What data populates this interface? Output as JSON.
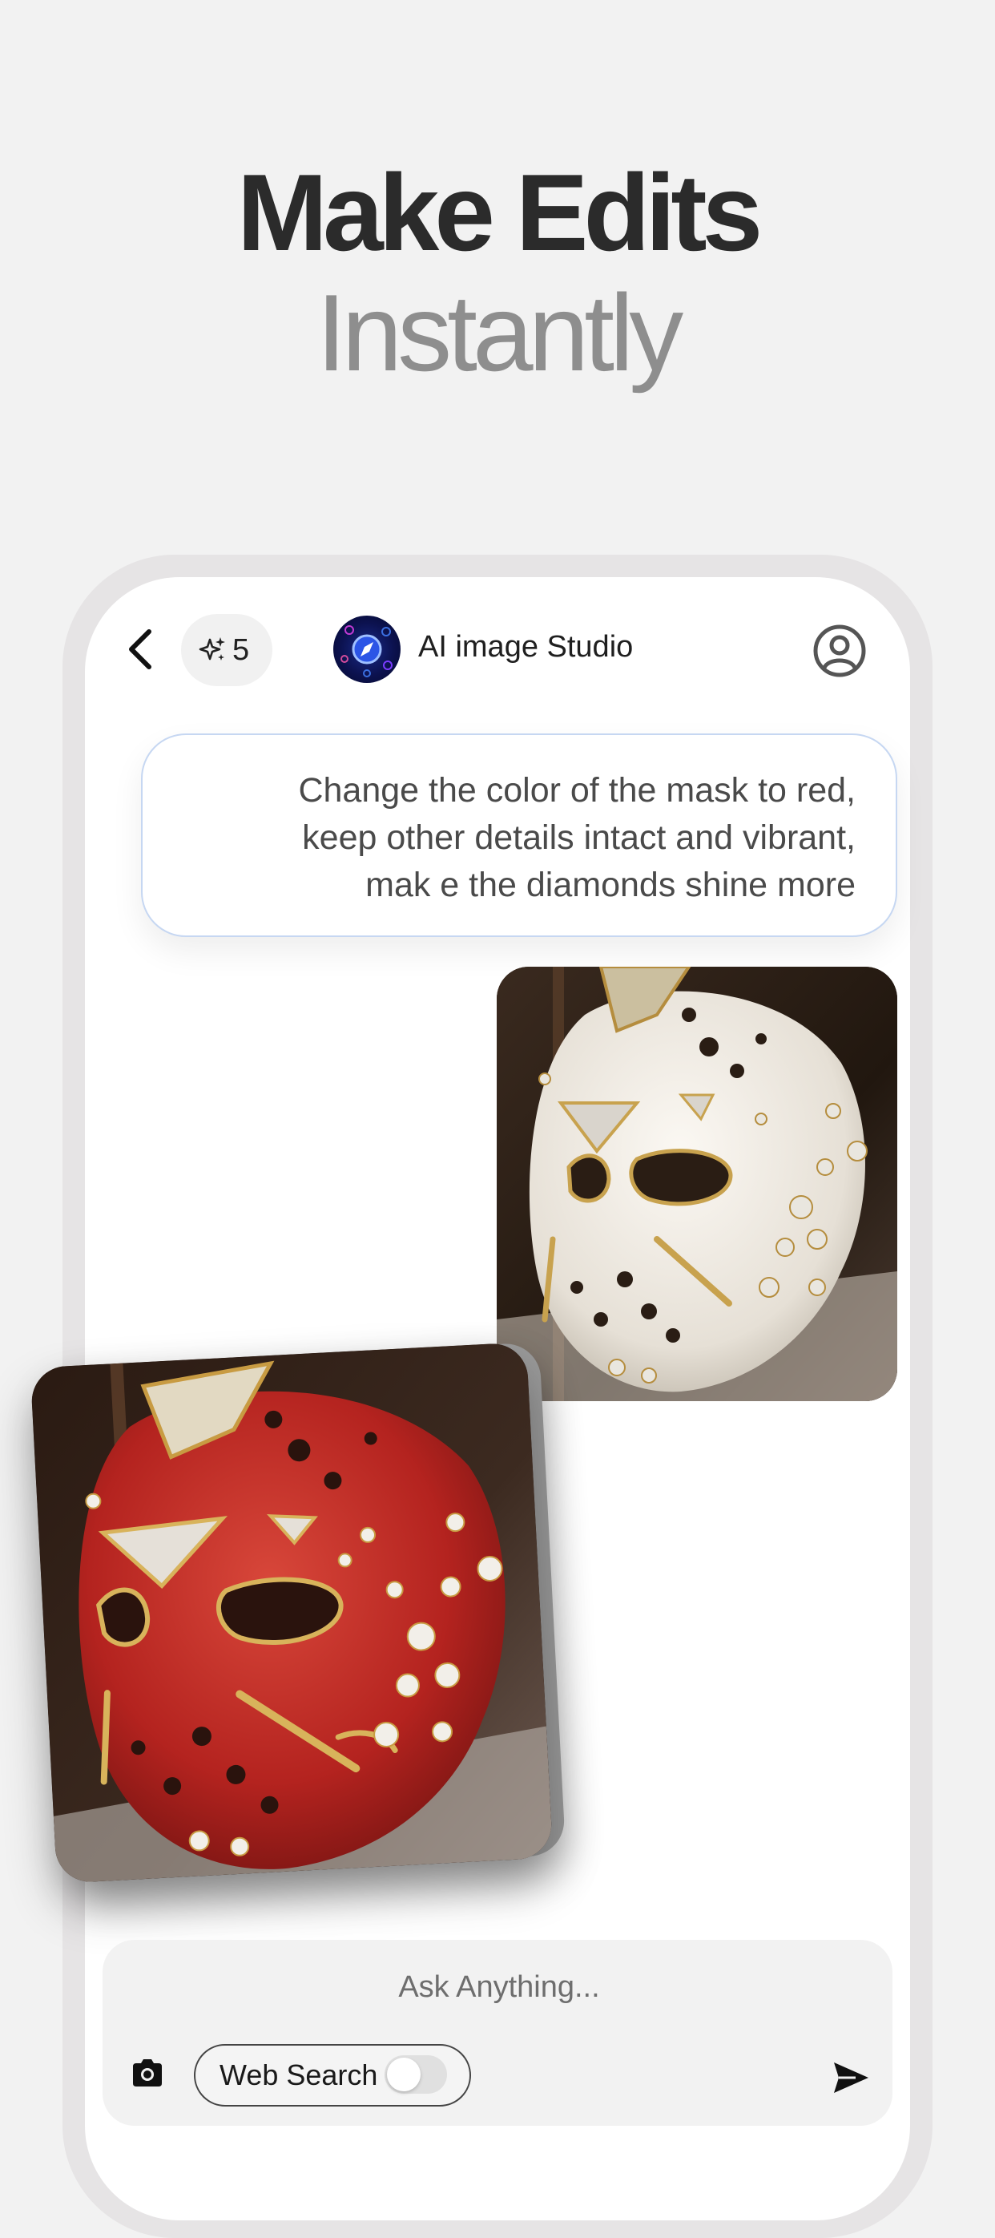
{
  "hero": {
    "title": "Make Edits",
    "subtitle": "Instantly"
  },
  "header": {
    "back_icon": "chevron-left-icon",
    "credits_icon": "sparkles-icon",
    "credits": "5",
    "app_logo": "compass-app-logo",
    "app_title": "AI image Studio",
    "profile_icon": "user-circle-icon"
  },
  "prompt": {
    "line1": "Change the color of the mask to red,",
    "line2": "keep other details intact and vibrant,",
    "line3": "mak e the diamonds shine more"
  },
  "images": {
    "original": "white jeweled hockey-style mask",
    "edited": "red jeweled hockey-style mask"
  },
  "composer": {
    "placeholder": "Ask Anything...",
    "camera_icon": "camera-icon",
    "web_search_label": "Web Search",
    "web_search_enabled": false,
    "send_icon": "send-icon"
  },
  "colors": {
    "background": "#f2f2f2",
    "title_dark": "#2b2b2b",
    "title_gray": "#8e8e8e",
    "bubble_border": "#c6d7f2",
    "mask_red": "#b4231f",
    "mask_white": "#ece7df"
  }
}
